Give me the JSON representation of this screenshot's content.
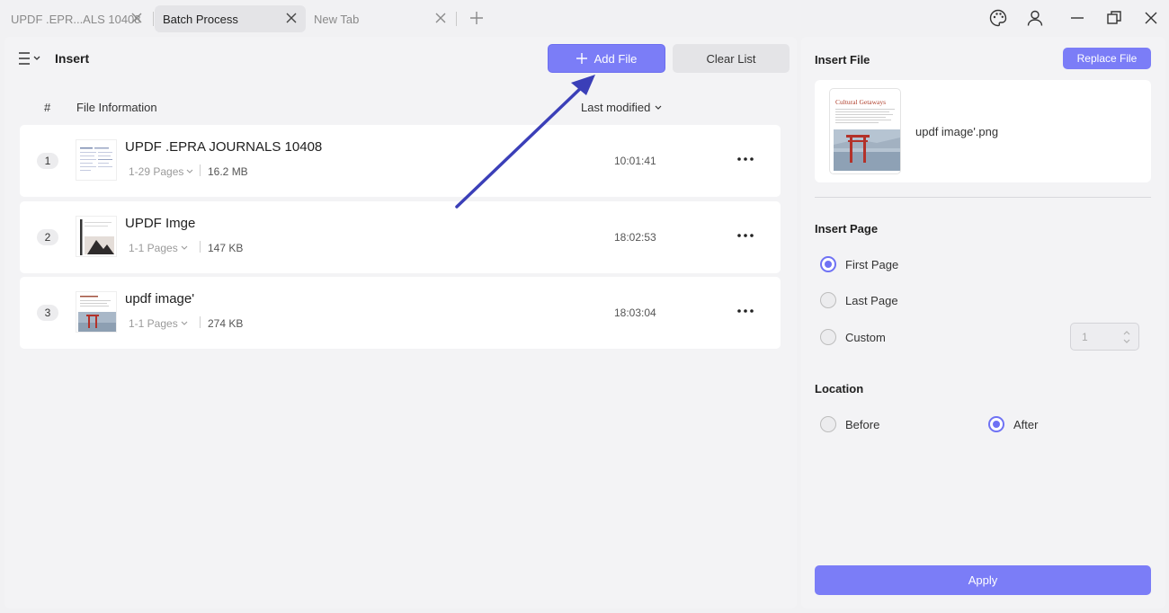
{
  "tabs": [
    {
      "label": "UPDF .EPR...ALS 10408"
    },
    {
      "label": "Batch Process"
    },
    {
      "label": "New Tab"
    }
  ],
  "window_icons": [
    "palette-icon",
    "user-icon",
    "minimize-icon",
    "restore-icon",
    "close-icon"
  ],
  "left_panel": {
    "title": "Insert",
    "add_file_label": "Add File",
    "clear_list_label": "Clear List",
    "columns": {
      "index": "#",
      "info": "File Information",
      "modified": "Last modified"
    },
    "files": [
      {
        "index": "1",
        "name": "UPDF .EPRA JOURNALS 10408",
        "pages": "1-29 Pages",
        "size": "16.2 MB",
        "time": "10:01:41"
      },
      {
        "index": "2",
        "name": "UPDF Imge",
        "pages": "1-1 Pages",
        "size": "147 KB",
        "time": "18:02:53"
      },
      {
        "index": "3",
        "name": "updf image'",
        "pages": "1-1 Pages",
        "size": "274 KB",
        "time": "18:03:04"
      }
    ]
  },
  "right_panel": {
    "insert_file_title": "Insert File",
    "replace_file_label": "Replace File",
    "selected_file": "updf image'.png",
    "thumb_heading": "Cultural Getaways",
    "insert_page_title": "Insert Page",
    "insert_page_options": [
      {
        "label": "First Page",
        "selected": true
      },
      {
        "label": "Last Page",
        "selected": false
      },
      {
        "label": "Custom",
        "selected": false
      }
    ],
    "custom_value": "1",
    "location_title": "Location",
    "location_options": [
      {
        "label": "Before",
        "selected": false
      },
      {
        "label": "After",
        "selected": true
      }
    ],
    "apply_label": "Apply"
  },
  "colors": {
    "accent": "#7b7df7",
    "arrow": "#3b3fb8"
  }
}
